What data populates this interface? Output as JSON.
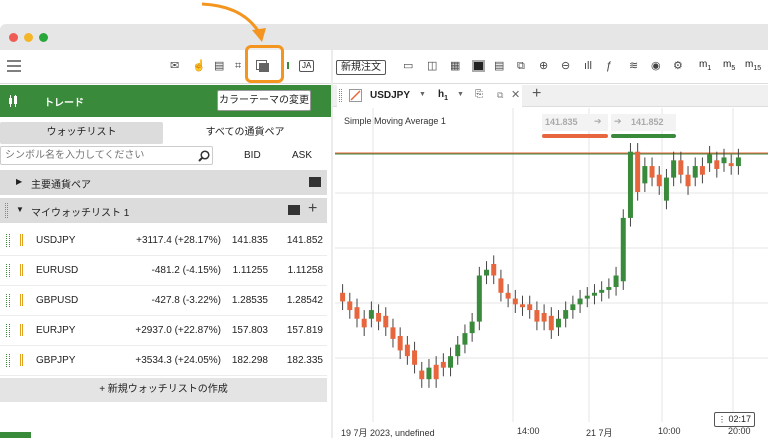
{
  "window": {
    "controls": [
      "close",
      "minimize",
      "zoom"
    ]
  },
  "sidebar": {
    "trade_label": "トレード",
    "tooltip": "カラーテーマの変更",
    "tabs": [
      {
        "label": "ウォッチリスト",
        "active": true
      },
      {
        "label": "すべての通貨ペア",
        "active": false
      }
    ],
    "search_placeholder": "シンボル名を入力してください",
    "bid_header": "BID",
    "ask_header": "ASK",
    "section_major": "主要通貨ペア",
    "section_watchlist": "マイウォッチリスト 1",
    "rows": [
      {
        "symbol": "USDJPY",
        "change": "+3117.4 (+28.17%)",
        "bid": "141.835",
        "ask": "141.852"
      },
      {
        "symbol": "EURUSD",
        "change": "-481.2 (-4.15%)",
        "bid": "1.11255",
        "ask": "1.11258"
      },
      {
        "symbol": "GBPUSD",
        "change": "-427.8 (-3.22%)",
        "bid": "1.28535",
        "ask": "1.28542"
      },
      {
        "symbol": "EURJPY",
        "change": "+2937.0 (+22.87%)",
        "bid": "157.803",
        "ask": "157.819"
      },
      {
        "symbol": "GBPJPY",
        "change": "+3534.3 (+24.05%)",
        "bid": "182.298",
        "ask": "182.335"
      }
    ],
    "add_watchlist": "+ 新規ウォッチリストの作成"
  },
  "toolbar": {
    "new_order": "新規注文",
    "timeframes": [
      "m1",
      "m5",
      "m15"
    ],
    "ja_badge": "JA"
  },
  "chart": {
    "tab_symbol": "USDJPY",
    "tab_timeframe": "h",
    "tab_timeframe_sub": "1",
    "indicator": "Simple Moving Average 1",
    "sell_price": "141.835",
    "buy_price": "141.852",
    "x_labels": [
      "19 7月 2023, undefined",
      "14:00",
      "21 7月",
      "10:00",
      "20:00"
    ],
    "clock": "02:17",
    "colors": {
      "up": "#3a8a3c",
      "down": "#e8663d"
    }
  },
  "chart_data": {
    "type": "candlestick",
    "title": "Simple Moving Average 1",
    "x": [
      "19 7月 2023, undefined",
      "14:00",
      "21 7月",
      "10:00",
      "20:00"
    ],
    "series": [
      {
        "values": [
          [
            0.4,
            0.37
          ],
          [
            0.37,
            0.34
          ],
          [
            0.35,
            0.31
          ],
          [
            0.31,
            0.28
          ],
          [
            0.31,
            0.34
          ],
          [
            0.33,
            0.3
          ],
          [
            0.32,
            0.28
          ],
          [
            0.28,
            0.24
          ],
          [
            0.25,
            0.2
          ],
          [
            0.22,
            0.18
          ],
          [
            0.2,
            0.15
          ],
          [
            0.13,
            0.1
          ],
          [
            0.1,
            0.14
          ],
          [
            0.15,
            0.1
          ],
          [
            0.16,
            0.14
          ],
          [
            0.14,
            0.18
          ],
          [
            0.18,
            0.22
          ],
          [
            0.22,
            0.26
          ],
          [
            0.26,
            0.3
          ],
          [
            0.3,
            0.46
          ],
          [
            0.46,
            0.48
          ],
          [
            0.5,
            0.46
          ],
          [
            0.45,
            0.4
          ],
          [
            0.4,
            0.38
          ],
          [
            0.38,
            0.36
          ],
          [
            0.36,
            0.35
          ],
          [
            0.36,
            0.34
          ],
          [
            0.34,
            0.3
          ],
          [
            0.33,
            0.3
          ],
          [
            0.32,
            0.27
          ],
          [
            0.28,
            0.31
          ],
          [
            0.31,
            0.34
          ],
          [
            0.34,
            0.36
          ],
          [
            0.36,
            0.38
          ],
          [
            0.38,
            0.39
          ],
          [
            0.39,
            0.4
          ],
          [
            0.4,
            0.41
          ],
          [
            0.41,
            0.42
          ],
          [
            0.42,
            0.46
          ],
          [
            0.44,
            0.66
          ],
          [
            0.66,
            0.89
          ],
          [
            0.89,
            0.75
          ],
          [
            0.78,
            0.84
          ],
          [
            0.84,
            0.8
          ],
          [
            0.81,
            0.77
          ],
          [
            0.72,
            0.8
          ],
          [
            0.8,
            0.86
          ],
          [
            0.86,
            0.81
          ],
          [
            0.81,
            0.77
          ],
          [
            0.8,
            0.84
          ],
          [
            0.84,
            0.81
          ],
          [
            0.85,
            0.88
          ],
          [
            0.86,
            0.83
          ],
          [
            0.85,
            0.87
          ],
          [
            0.85,
            0.84
          ],
          [
            0.84,
            0.87
          ]
        ]
      }
    ]
  }
}
